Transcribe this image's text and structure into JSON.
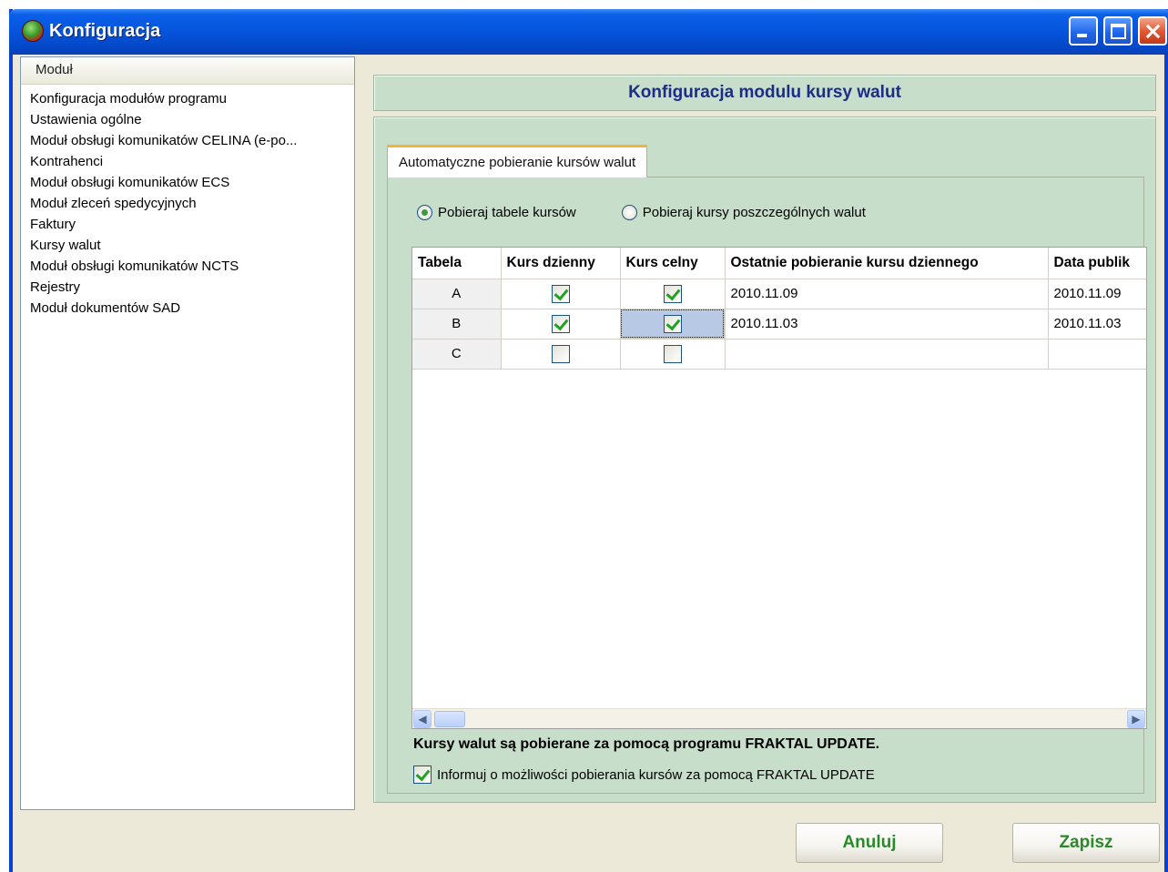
{
  "window": {
    "title": "Konfiguracja"
  },
  "sidebar": {
    "header": "Moduł",
    "items": [
      "Konfiguracja modułów programu",
      "Ustawienia ogólne",
      "Moduł obsługi komunikatów CELINA (e-po...",
      "Kontrahenci",
      "Moduł obsługi komunikatów ECS",
      "Moduł zleceń spedycyjnych",
      "Faktury",
      "Kursy walut",
      "Moduł obsługi komunikatów NCTS",
      "Rejestry",
      "Moduł dokumentów SAD"
    ]
  },
  "panel": {
    "title": "Konfiguracja modulu kursy walut",
    "tab_label": "Automatyczne pobieranie kursów walut",
    "radio_tables": "Pobieraj tabele kursów",
    "radio_tables_selected": true,
    "radio_currencies": "Pobieraj kursy poszczególnych walut",
    "radio_currencies_selected": false,
    "columns": [
      "Tabela",
      "Kurs dzienny",
      "Kurs celny",
      "Ostatnie pobieranie kursu dziennego",
      "Data publik"
    ],
    "rows": [
      {
        "tabela": "A",
        "kurs_dzienny": true,
        "kurs_celny": true,
        "ostatnie": "2010.11.09",
        "data_publik": "2010.11.09"
      },
      {
        "tabela": "B",
        "kurs_dzienny": true,
        "kurs_celny": true,
        "ostatnie": "2010.11.03",
        "data_publik": "2010.11.03"
      },
      {
        "tabela": "C",
        "kurs_dzienny": false,
        "kurs_celny": false,
        "ostatnie": "",
        "data_publik": ""
      }
    ],
    "info_text": "Kursy walut są pobierane za pomocą programu FRAKTAL UPDATE.",
    "info_checkbox_label": "Informuj o możliwości pobierania kursów za pomocą FRAKTAL UPDATE",
    "info_checkbox_checked": true
  },
  "buttons": {
    "cancel": "Anuluj",
    "save": "Zapisz"
  },
  "colors": {
    "title_blue": "#0654dc",
    "panel_green": "#c7dfca",
    "header_text": "#1d2c8a",
    "button_text": "#2a8a2a"
  }
}
